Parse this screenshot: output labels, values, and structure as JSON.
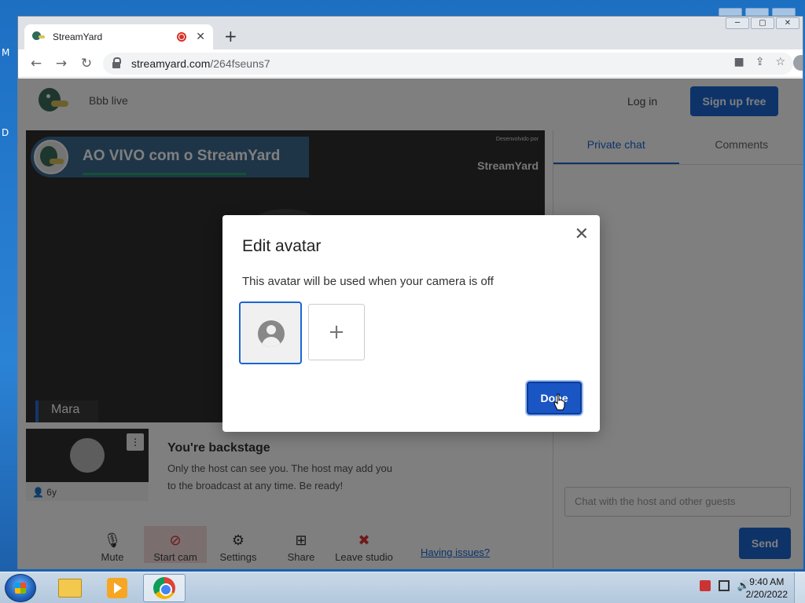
{
  "desktop": {
    "frag_top": "M",
    "frag_mid": "D"
  },
  "browser": {
    "tab_title": "StreamYard",
    "tab_close": "✕",
    "new_tab": "+",
    "url_host": "streamyard.com",
    "url_path": "/264fseuns7",
    "nav": {
      "back": "←",
      "forward": "→",
      "reload": "↻"
    }
  },
  "header": {
    "broadcast_name": "Bbb live",
    "login_label": "Log in",
    "signup_label": "Sign up free"
  },
  "stage": {
    "banner_text": "AO VIVO com o StreamYard",
    "powered_by": "Desenvolvido por",
    "powered_brand": "StreamYard",
    "participant_name": "Mara"
  },
  "guest": {
    "id_label": "6y"
  },
  "backstage": {
    "title": "You're backstage",
    "line1": "Only the host can see you. The host may add you",
    "line2": "to the broadcast at any time. Be ready!"
  },
  "controls": [
    {
      "label": "Mute",
      "icon": "🎙"
    },
    {
      "label": "Start cam",
      "icon": "⊘"
    },
    {
      "label": "Settings",
      "icon": "⚙"
    },
    {
      "label": "Share",
      "icon": "⊞"
    },
    {
      "label": "Leave studio",
      "icon": "✖"
    }
  ],
  "issues_link": "Having issues?",
  "chat": {
    "tab_private": "Private chat",
    "tab_comments": "Comments",
    "input_placeholder": "Chat with the host and other guests",
    "send_label": "Send"
  },
  "modal": {
    "title": "Edit avatar",
    "description": "This avatar will be used when your camera is off",
    "add_label": "+",
    "done_label": "Done",
    "close": "✕"
  },
  "taskbar": {
    "time": "9:40 AM",
    "date": "2/20/2022"
  },
  "colors": {
    "accent": "#1a66d2",
    "danger": "#d93025"
  }
}
